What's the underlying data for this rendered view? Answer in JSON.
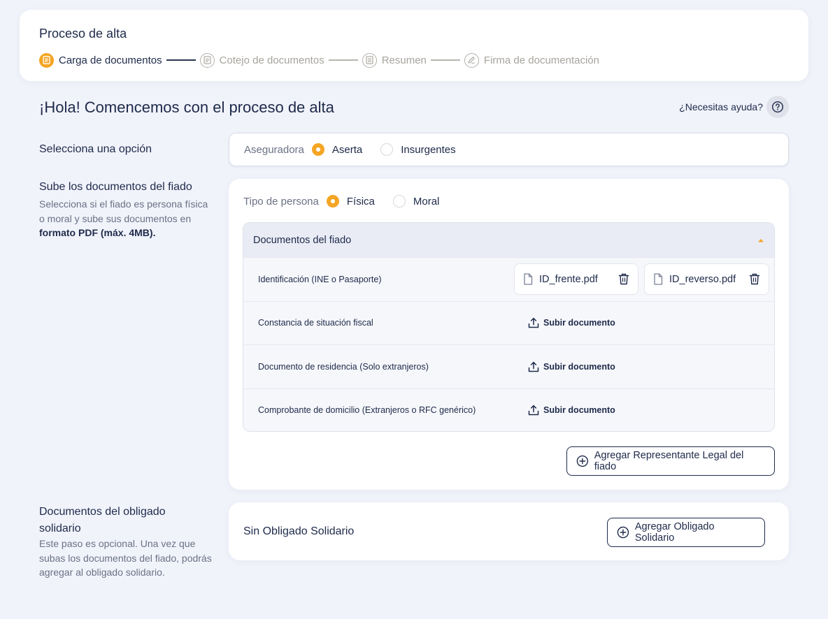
{
  "stepper": {
    "title": "Proceso de alta",
    "steps": [
      {
        "label": "Carga de documentos",
        "active": true,
        "icon": "document-icon"
      },
      {
        "label": "Cotejo de documentos",
        "active": false,
        "icon": "document-check-icon"
      },
      {
        "label": "Resumen",
        "active": false,
        "icon": "summary-icon"
      },
      {
        "label": "Firma de documentación",
        "active": false,
        "icon": "pen-icon"
      }
    ]
  },
  "greeting": "¡Hola! Comencemos con el proceso de alta",
  "help": {
    "label": "¿Necesitas ayuda?",
    "icon": "question-icon"
  },
  "option_section": {
    "label": "Selecciona una opción",
    "radio_label": "Aseguradora",
    "options": [
      {
        "label": "Aserta",
        "selected": true
      },
      {
        "label": "Insurgentes",
        "selected": false
      }
    ]
  },
  "fiado_section": {
    "label": "Sube los documentos del fiado",
    "desc_pre": "Selecciona si el fiado es persona física o moral y sube sus documentos en ",
    "desc_bold": "formato PDF (máx. 4MB).",
    "radio_label": "Tipo de persona",
    "options": [
      {
        "label": "Física",
        "selected": true
      },
      {
        "label": "Moral",
        "selected": false
      }
    ],
    "accordion_title": "Documentos del fiado",
    "upload_label": "Subir documento",
    "documents": [
      {
        "name": "Identificación (INE o Pasaporte)",
        "files": [
          "ID_frente.pdf",
          "ID_reverso.pdf"
        ]
      },
      {
        "name": "Constancia de situación fiscal",
        "files": []
      },
      {
        "name": "Documento de residencia (Solo extranjeros)",
        "files": []
      },
      {
        "name": "Comprobante de domicilio (Extranjeros o RFC genérico)",
        "files": []
      }
    ],
    "add_button": "Agregar Representante Legal del fiado"
  },
  "obligado_section": {
    "label": "Documentos del obligado solidario",
    "desc": "Este paso es opcional. Una vez que subas los documentos del fiado, podrás agregar al obligado solidario.",
    "empty_title": "Sin Obligado Solidario",
    "add_button": "Agregar Obligado Solidario"
  },
  "colors": {
    "accent": "#f5a524",
    "text": "#1e2a4a",
    "muted": "#6a7184",
    "background": "#f1f3fb"
  }
}
